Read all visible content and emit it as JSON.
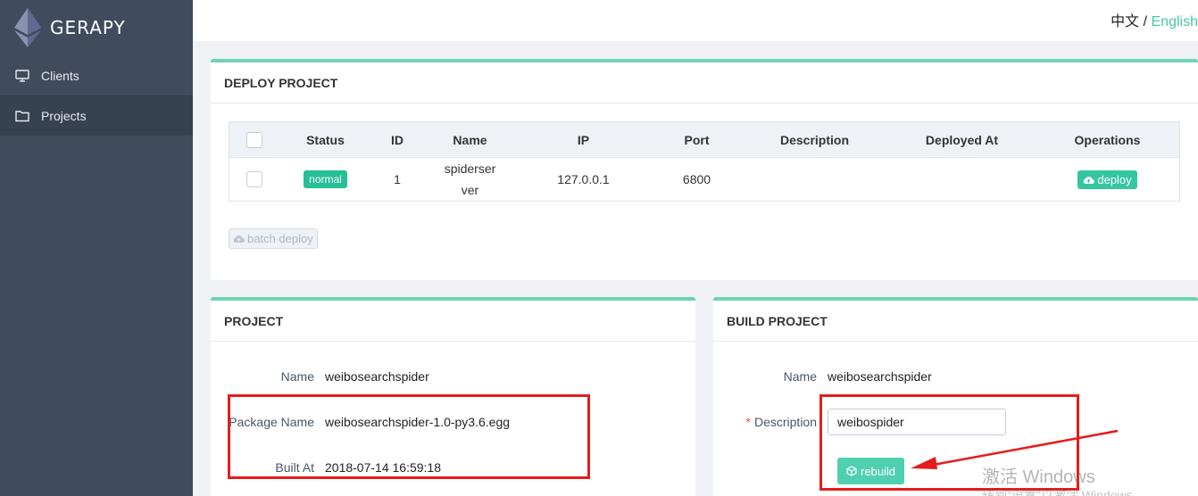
{
  "app": {
    "name": "GERAPY"
  },
  "sidebar": {
    "items": [
      {
        "label": "Clients",
        "icon": "monitor-icon",
        "active": false
      },
      {
        "label": "Projects",
        "icon": "folder-icon",
        "active": true
      }
    ]
  },
  "header": {
    "lang_zh": "中文",
    "lang_sep": " / ",
    "lang_en": "English"
  },
  "deploy": {
    "title": "DEPLOY PROJECT",
    "columns": [
      "Status",
      "ID",
      "Name",
      "IP",
      "Port",
      "Description",
      "Deployed At",
      "Operations"
    ],
    "rows": [
      {
        "status": "normal",
        "id": "1",
        "name": "spiderserver",
        "ip": "127.0.0.1",
        "port": "6800",
        "description": "",
        "deployed_at": "",
        "op_label": "deploy"
      }
    ],
    "batch_label": "batch deploy"
  },
  "project": {
    "title": "PROJECT",
    "name_label": "Name",
    "name_value": "weibosearchspider",
    "package_label": "Package Name",
    "package_value": "weibosearchspider-1.0-py3.6.egg",
    "built_label": "Built At",
    "built_value": "2018-07-14 16:59:18"
  },
  "build": {
    "title": "BUILD PROJECT",
    "name_label": "Name",
    "name_value": "weibosearchspider",
    "desc_required": "*",
    "desc_label": "Description",
    "desc_value": "weibospider",
    "rebuild_label": "rebuild"
  },
  "watermark": {
    "line1": "激活 Windows",
    "line2": "转到\"设置\"以激活 Windows。"
  },
  "colors": {
    "accent": "#44c8a8",
    "sidebar": "#404c5d",
    "annotation": "#e51c1c"
  }
}
